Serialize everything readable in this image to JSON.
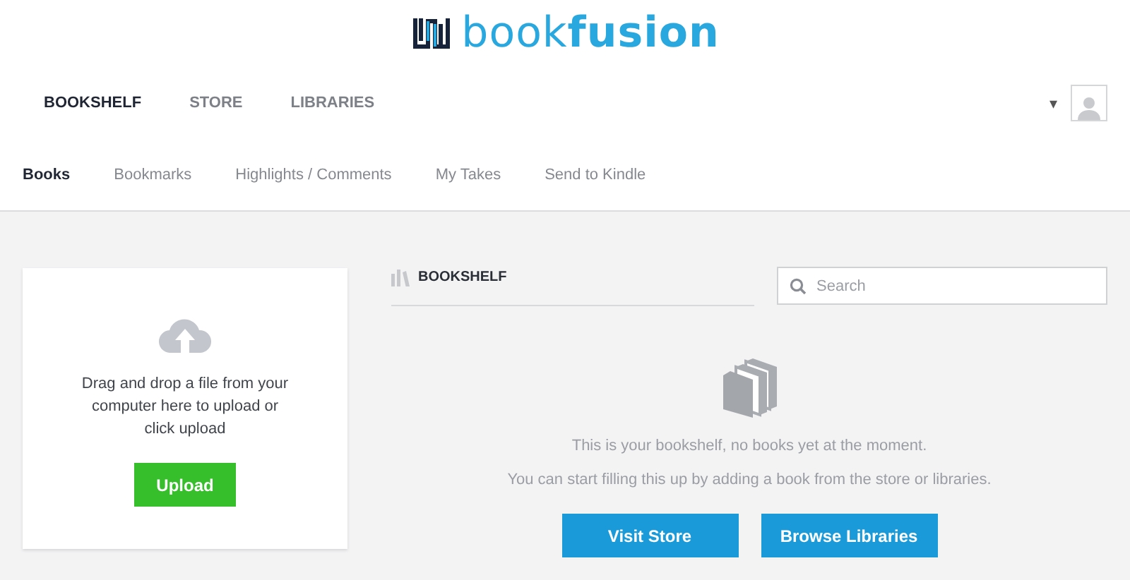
{
  "logo": {
    "text": "book**fusion**"
  },
  "nav": [
    {
      "label": "BOOKSHELF",
      "selected": true
    },
    {
      "label": "STORE",
      "selected": false
    },
    {
      "label": "LIBRARIES",
      "selected": false
    }
  ],
  "account": {
    "caret": "▾"
  },
  "tabs": [
    {
      "label": "Books",
      "selected": true
    },
    {
      "label": "Bookmarks",
      "selected": false
    },
    {
      "label": "Highlights / Comments",
      "selected": false
    },
    {
      "label": "My Takes",
      "selected": false
    },
    {
      "label": "Send to Kindle",
      "selected": false
    }
  ],
  "upload_card": {
    "text": "Drag and drop a file from your computer here to upload or click upload",
    "button": "Upload"
  },
  "bookshelf": {
    "heading": "BOOKSHELF",
    "search": {
      "placeholder": "Search"
    },
    "empty_lines": [
      "This is your bookshelf, no books yet at the moment.",
      "You can start filling this up by adding a book from the store or libraries."
    ],
    "buttons": [
      "Visit Store",
      "Browse Libraries"
    ]
  }
}
